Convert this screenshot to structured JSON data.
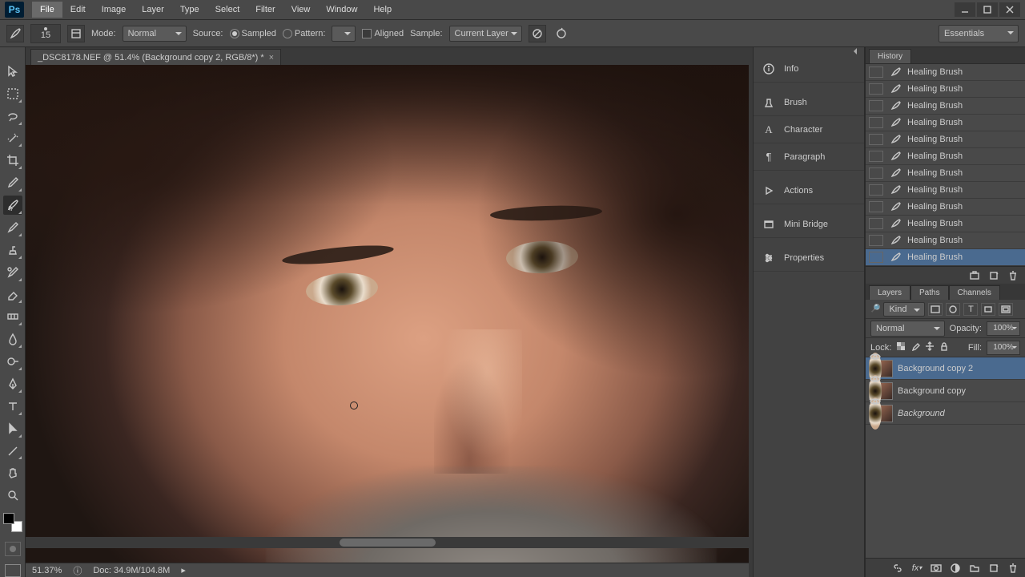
{
  "menu": {
    "items": [
      "File",
      "Edit",
      "Image",
      "Layer",
      "Type",
      "Select",
      "Filter",
      "View",
      "Window",
      "Help"
    ],
    "highlighted": 0
  },
  "optbar": {
    "brush_size": "15",
    "mode_label": "Mode:",
    "mode_value": "Normal",
    "source_label": "Source:",
    "sampled": "Sampled",
    "pattern": "Pattern:",
    "aligned": "Aligned",
    "sample_label": "Sample:",
    "sample_value": "Current Layer",
    "workspace": "Essentials"
  },
  "doc": {
    "tab_title": "_DSC8178.NEF @ 51.4% (Background copy 2, RGB/8*) *",
    "zoom": "51.37%",
    "docinfo": "Doc: 34.9M/104.8M"
  },
  "dock": {
    "items": [
      {
        "icon": "info",
        "label": "Info"
      },
      {
        "icon": "brush",
        "label": "Brush"
      },
      {
        "icon": "character",
        "label": "Character"
      },
      {
        "icon": "paragraph",
        "label": "Paragraph"
      },
      {
        "icon": "actions",
        "label": "Actions"
      },
      {
        "icon": "minibridge",
        "label": "Mini Bridge"
      },
      {
        "icon": "properties",
        "label": "Properties"
      }
    ]
  },
  "history": {
    "tab": "History",
    "items": [
      "Healing Brush",
      "Healing Brush",
      "Healing Brush",
      "Healing Brush",
      "Healing Brush",
      "Healing Brush",
      "Healing Brush",
      "Healing Brush",
      "Healing Brush",
      "Healing Brush",
      "Healing Brush",
      "Healing Brush"
    ],
    "selected": 11
  },
  "layers": {
    "tabs": [
      "Layers",
      "Paths",
      "Channels"
    ],
    "active_tab": 0,
    "kind_label": "Kind",
    "blend_mode": "Normal",
    "opacity_label": "Opacity:",
    "opacity_value": "100%",
    "lock_label": "Lock:",
    "fill_label": "Fill:",
    "fill_value": "100%",
    "items": [
      {
        "name": "Background copy 2",
        "selected": true,
        "italic": false
      },
      {
        "name": "Background copy",
        "selected": false,
        "italic": false
      },
      {
        "name": "Background",
        "selected": false,
        "italic": true
      }
    ]
  }
}
